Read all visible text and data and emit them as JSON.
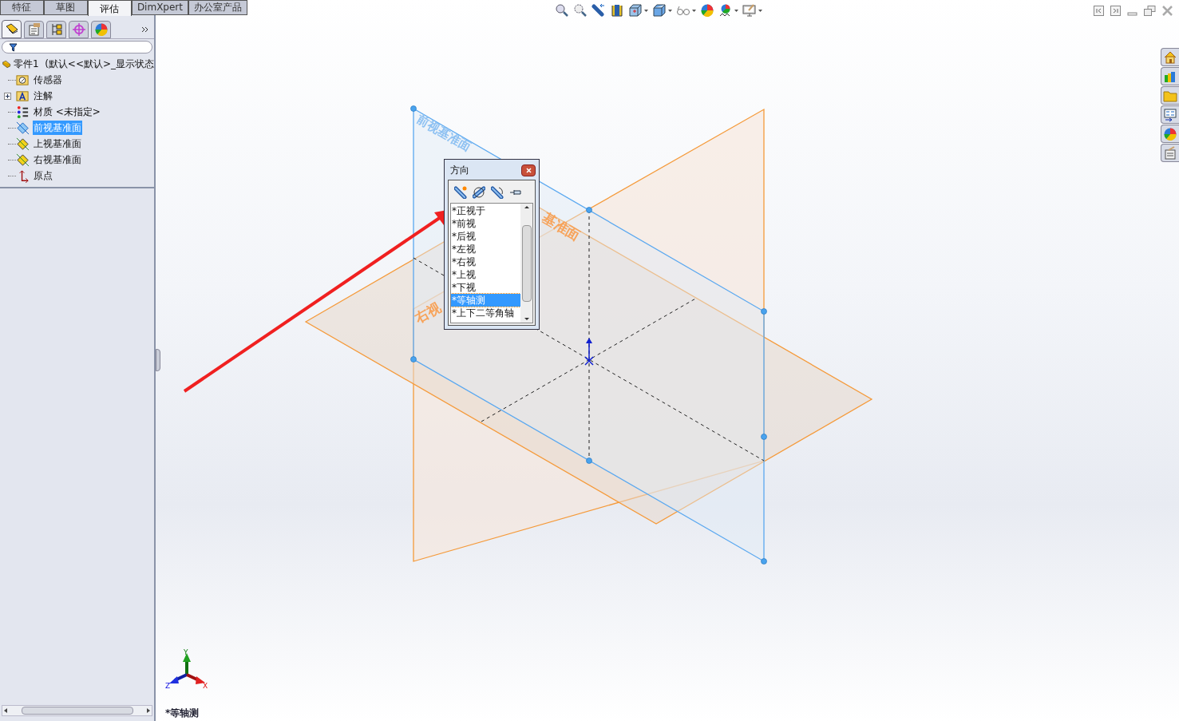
{
  "command_tabs": [
    {
      "label": "特征",
      "selected": false
    },
    {
      "label": "草图",
      "selected": false
    },
    {
      "label": "评估",
      "selected": true
    },
    {
      "label": "DimXpert",
      "selected": false
    },
    {
      "label": "办公室产品",
      "selected": false
    }
  ],
  "panel_tabs": [
    {
      "kind": "tree",
      "selected": true
    },
    {
      "kind": "property",
      "selected": false
    },
    {
      "kind": "config",
      "selected": false
    },
    {
      "kind": "dimxpert",
      "selected": false
    },
    {
      "kind": "display",
      "selected": false
    }
  ],
  "feature_tree": {
    "root": "零件1  (默认<<默认>_显示状态",
    "items": [
      {
        "kind": "sensor",
        "label": "传感器",
        "collapsed": false,
        "selected": false
      },
      {
        "kind": "annotation",
        "label": "注解",
        "collapsed": true,
        "selected": false
      },
      {
        "kind": "material",
        "label": "材质 <未指定>",
        "collapsed": false,
        "selected": false
      },
      {
        "kind": "plane-front",
        "label": "前视基准面",
        "collapsed": false,
        "selected": true
      },
      {
        "kind": "plane",
        "label": "上视基准面",
        "collapsed": false,
        "selected": false
      },
      {
        "kind": "plane",
        "label": "右视基准面",
        "collapsed": false,
        "selected": false
      },
      {
        "kind": "origin",
        "label": "原点",
        "collapsed": false,
        "selected": false
      }
    ]
  },
  "viewport": {
    "plane_labels": [
      "前视基准面",
      "基准面",
      "右视"
    ],
    "orientation_dialog": {
      "title": "方向",
      "views": [
        {
          "label": "*正视于",
          "selected": false
        },
        {
          "label": "*前视",
          "selected": false
        },
        {
          "label": "*后视",
          "selected": false
        },
        {
          "label": "*左视",
          "selected": false
        },
        {
          "label": "*右视",
          "selected": false
        },
        {
          "label": "*上视",
          "selected": false
        },
        {
          "label": "*下视",
          "selected": false
        },
        {
          "label": "*等轴测",
          "selected": true
        },
        {
          "label": "*上下二等角轴",
          "selected": false
        }
      ]
    },
    "triad_labels": [
      "Y",
      "Z",
      "X"
    ],
    "view_name": "*等轴测"
  }
}
